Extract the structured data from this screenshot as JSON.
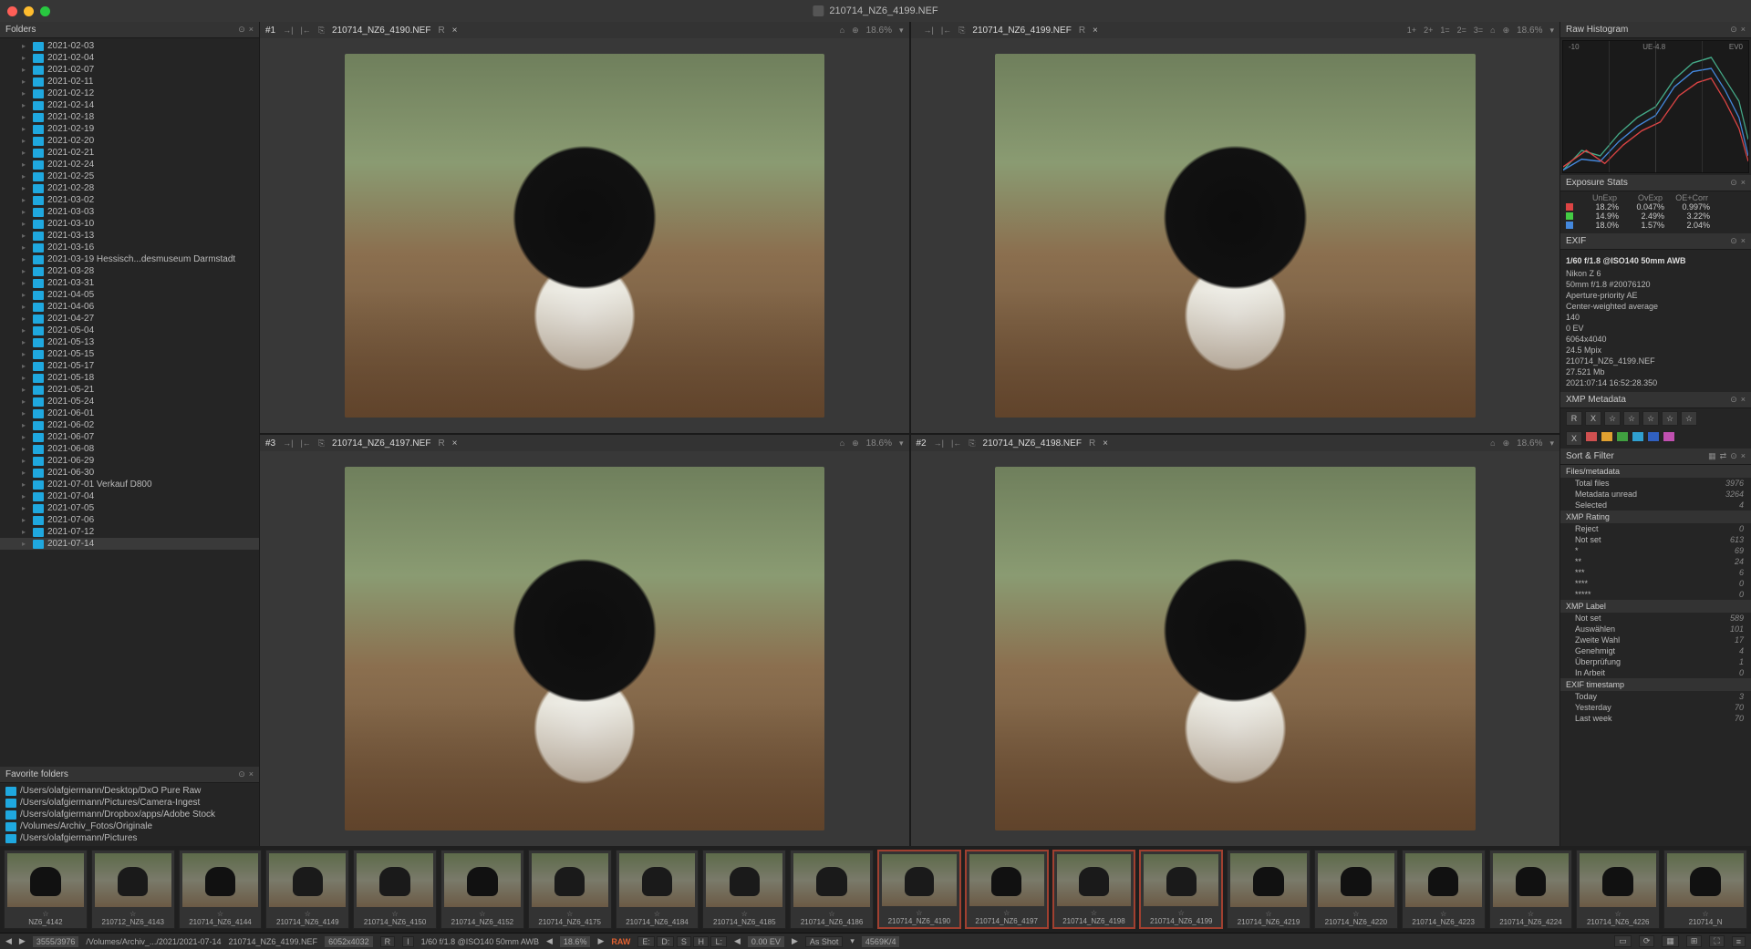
{
  "window": {
    "title": "210714_NZ6_4199.NEF"
  },
  "panels": {
    "folders_title": "Folders",
    "favorites_title": "Favorite folders",
    "histogram_title": "Raw Histogram",
    "expstats_title": "Exposure Stats",
    "exif_title": "EXIF",
    "xmp_title": "XMP Metadata",
    "sortfilter_title": "Sort & Filter"
  },
  "folders": [
    "2021-02-03",
    "2021-02-04",
    "2021-02-07",
    "2021-02-11",
    "2021-02-12",
    "2021-02-14",
    "2021-02-18",
    "2021-02-19",
    "2021-02-20",
    "2021-02-21",
    "2021-02-24",
    "2021-02-25",
    "2021-02-28",
    "2021-03-02",
    "2021-03-03",
    "2021-03-10",
    "2021-03-13",
    "2021-03-16",
    "2021-03-19 Hessisch...desmuseum Darmstadt",
    "2021-03-28",
    "2021-03-31",
    "2021-04-05",
    "2021-04-06",
    "2021-04-27",
    "2021-05-04",
    "2021-05-13",
    "2021-05-15",
    "2021-05-17",
    "2021-05-18",
    "2021-05-21",
    "2021-05-24",
    "2021-06-01",
    "2021-06-02",
    "2021-06-07",
    "2021-06-08",
    "2021-06-29",
    "2021-06-30",
    "2021-07-01 Verkauf D800",
    "2021-07-04",
    "2021-07-05",
    "2021-07-06",
    "2021-07-12",
    "2021-07-14"
  ],
  "folders_selected": "2021-07-14",
  "favorites": [
    "/Users/olafgiermann/Desktop/DxO Pure Raw",
    "/Users/olafgiermann/Pictures/Camera-Ingest",
    "/Users/olafgiermann/Dropbox/apps/Adobe Stock",
    "/Volumes/Archiv_Fotos/Originale",
    "/Users/olafgiermann/Pictures"
  ],
  "viewers": [
    {
      "slot": "#1",
      "name": "210714_NZ6_4190.NEF",
      "zoom": "18.6%",
      "tag": "R"
    },
    {
      "slot": "",
      "name": "210714_NZ6_4199.NEF",
      "zoom": "18.6%",
      "tag": "R",
      "extra": [
        "1+",
        "2+",
        "1=",
        "2=",
        "3="
      ]
    },
    {
      "slot": "#3",
      "name": "210714_NZ6_4197.NEF",
      "zoom": "18.6%",
      "tag": "R"
    },
    {
      "slot": "#2",
      "name": "210714_NZ6_4198.NEF",
      "zoom": "18.6%",
      "tag": "R"
    }
  ],
  "histogram": {
    "labels": [
      "-10",
      "UE-4.8",
      "EV0"
    ]
  },
  "exposure_stats": {
    "headers": [
      "UnExp",
      "OvExp",
      "OE+Corr"
    ],
    "rows": [
      {
        "ch": "R",
        "vals": [
          "18.2%",
          "0.047%",
          "0.997%"
        ]
      },
      {
        "ch": "G",
        "vals": [
          "14.9%",
          "2.49%",
          "3.22%"
        ]
      },
      {
        "ch": "B",
        "vals": [
          "18.0%",
          "1.57%",
          "2.04%"
        ]
      }
    ]
  },
  "exif": {
    "headline": "1/60 f/1.8 @ISO140 50mm AWB",
    "lines": [
      "Nikon Z 6",
      "50mm f/1.8 #20076120",
      "Aperture-priority AE",
      "Center-weighted average",
      "140",
      "0 EV",
      "6064x4040",
      "24.5 Mpix",
      "210714_NZ6_4199.NEF",
      "27.521 Mb",
      "2021:07:14 16:52:28.350"
    ]
  },
  "xmp": {
    "row1": [
      "R",
      "X",
      "☆",
      "☆",
      "☆",
      "☆",
      "☆"
    ],
    "row2_label": "X",
    "colors": [
      "#d05050",
      "#e0a030",
      "#40a040",
      "#30a0d0",
      "#3060c0",
      "#c050b0"
    ]
  },
  "sort_filter": {
    "files_meta_h": "Files/metadata",
    "files_meta": [
      [
        "Total files",
        "3976"
      ],
      [
        "Metadata unread",
        "3264"
      ],
      [
        "Selected",
        "4"
      ]
    ],
    "rating_h": "XMP Rating",
    "rating": [
      [
        "Reject",
        "0"
      ],
      [
        "Not set",
        "613"
      ],
      [
        "*",
        "69"
      ],
      [
        "**",
        "24"
      ],
      [
        "***",
        "6"
      ],
      [
        "****",
        "0"
      ],
      [
        "*****",
        "0"
      ]
    ],
    "label_h": "XMP Label",
    "label": [
      [
        "Not set",
        "589"
      ],
      [
        "Auswählen",
        "101"
      ],
      [
        "Zweite Wahl",
        "17"
      ],
      [
        "Genehmigt",
        "4"
      ],
      [
        "Überprüfung",
        "1"
      ],
      [
        "In Arbeit",
        "0"
      ]
    ],
    "exif_ts_h": "EXIF timestamp",
    "exif_ts": [
      [
        "Today",
        "3"
      ],
      [
        "Yesterday",
        "70"
      ],
      [
        "Last week",
        "70"
      ]
    ]
  },
  "filmstrip": [
    {
      "name": "NZ6_4142"
    },
    {
      "name": "210712_NZ6_4143"
    },
    {
      "name": "210714_NZ6_4144"
    },
    {
      "name": "210714_NZ6_4149"
    },
    {
      "name": "210714_NZ6_4150"
    },
    {
      "name": "210714_NZ6_4152"
    },
    {
      "name": "210714_NZ6_4175"
    },
    {
      "name": "210714_NZ6_4184"
    },
    {
      "name": "210714_NZ6_4185"
    },
    {
      "name": "210714_NZ6_4186"
    },
    {
      "name": "210714_NZ6_4190",
      "sel": true,
      "badge": true
    },
    {
      "name": "210714_NZ6_4197",
      "sel": true,
      "badge": true
    },
    {
      "name": "210714_NZ6_4198",
      "sel": true,
      "badge": true
    },
    {
      "name": "210714_NZ6_4199",
      "sel": true,
      "badge": true
    },
    {
      "name": "210714_NZ6_4219"
    },
    {
      "name": "210714_NZ6_4220"
    },
    {
      "name": "210714_NZ6_4223"
    },
    {
      "name": "210714_NZ6_4224"
    },
    {
      "name": "210714_NZ6_4226"
    },
    {
      "name": "210714_N"
    }
  ],
  "statusbar": {
    "counter": "3555/3976",
    "path": "/Volumes/Archiv_.../2021/2021-07-14",
    "file": "210714_NZ6_4199.NEF",
    "dims": "6052x4032",
    "R": "R",
    "I": "I",
    "exif": "1/60 f/1.8 @ISO140 50mm AWB",
    "zoom": "18.6%",
    "raw": "RAW",
    "letters": [
      "E:",
      "D:",
      "S",
      "H",
      "L:"
    ],
    "ev": "0.00 EV",
    "wb": "As Shot",
    "mem": "4569K/4"
  }
}
